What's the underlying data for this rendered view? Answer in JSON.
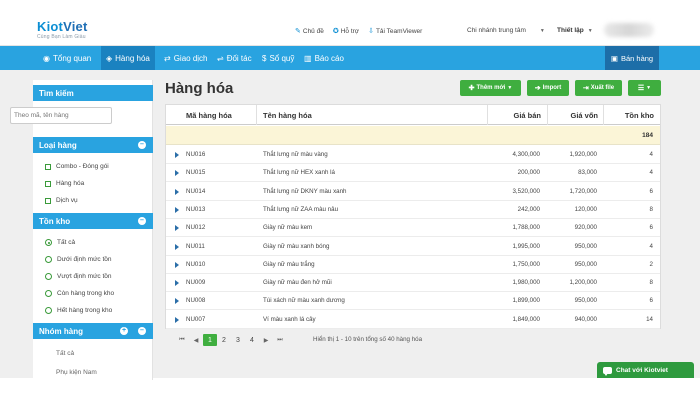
{
  "brand": {
    "name_part1": "Kiot",
    "name_part2": "Viet",
    "tagline": "Cùng Bạn Làm Giàu"
  },
  "topbar": {
    "links": [
      {
        "label": "Chủ đề",
        "icon": "brush-icon"
      },
      {
        "label": "Hỗ trợ",
        "icon": "support-icon"
      },
      {
        "label": "Tải TeamViewer",
        "icon": "download-icon"
      }
    ],
    "branch": "Chi nhánh trung tâm",
    "settings": "Thiết lập"
  },
  "nav": {
    "items": [
      {
        "label": "Tổng quan",
        "icon": "eye-icon"
      },
      {
        "label": "Hàng hóa",
        "icon": "box-icon",
        "active": true
      },
      {
        "label": "Giao dịch",
        "icon": "exchange-icon"
      },
      {
        "label": "Đối tác",
        "icon": "partner-icon"
      },
      {
        "label": "Sổ quỹ",
        "icon": "dollar-icon"
      },
      {
        "label": "Báo cáo",
        "icon": "chart-icon"
      }
    ],
    "sell": "Bán hàng"
  },
  "sidebar": {
    "search": {
      "title": "Tìm kiếm",
      "placeholder": "Theo mã, tên hàng"
    },
    "category": {
      "title": "Loại hàng",
      "options": [
        "Combo - Đóng gói",
        "Hàng hóa",
        "Dịch vụ"
      ]
    },
    "stock": {
      "title": "Tồn kho",
      "options": [
        "Tất cả",
        "Dưới định mức tồn",
        "Vượt định mức tồn",
        "Còn hàng trong kho",
        "Hết hàng trong kho"
      ],
      "selected": 0
    },
    "groups": {
      "title": "Nhóm hàng",
      "items": [
        "Tất cả",
        "Phụ kiện Nam"
      ]
    }
  },
  "main": {
    "title": "Hàng hóa",
    "buttons": {
      "add": "Thêm mới",
      "import": "Import",
      "export": "Xuất file"
    },
    "table": {
      "headers": [
        "Mã hàng hóa",
        "Tên hàng hóa",
        "Giá bán",
        "Giá vốn",
        "Tồn kho"
      ],
      "total_stock": "184",
      "rows": [
        [
          "NU016",
          "Thắt lưng nữ màu vàng",
          "4,300,000",
          "1,920,000",
          "4"
        ],
        [
          "NU015",
          "Thắt lưng nữ HEX xanh lá",
          "200,000",
          "83,000",
          "4"
        ],
        [
          "NU014",
          "Thắt lưng nữ DKNY màu xanh",
          "3,520,000",
          "1,720,000",
          "6"
        ],
        [
          "NU013",
          "Thắt lưng nữ ZAA màu nâu",
          "242,000",
          "120,000",
          "8"
        ],
        [
          "NU012",
          "Giày nữ màu kem",
          "1,788,000",
          "920,000",
          "6"
        ],
        [
          "NU011",
          "Giày nữ màu xanh bóng",
          "1,995,000",
          "950,000",
          "4"
        ],
        [
          "NU010",
          "Giày nữ màu trắng",
          "1,750,000",
          "950,000",
          "2"
        ],
        [
          "NU009",
          "Giày nữ màu đen hở mũi",
          "1,980,000",
          "1,200,000",
          "8"
        ],
        [
          "NU008",
          "Túi xách nữ màu xanh dương",
          "1,899,000",
          "950,000",
          "6"
        ],
        [
          "NU007",
          "Ví màu xanh lá cây",
          "1,849,000",
          "940,000",
          "14"
        ]
      ]
    },
    "pagination": {
      "pages": [
        "1",
        "2",
        "3",
        "4"
      ],
      "current": "1",
      "info": "Hiển thị 1 - 10 trên tổng số 40 hàng hóa"
    }
  },
  "chat": {
    "label": "Chat với Kiotviet"
  },
  "colors": {
    "primary": "#29a3e0",
    "primary_dark": "#1a82c0",
    "green": "#3fae3f",
    "summary_bg": "#fbf5d7"
  }
}
